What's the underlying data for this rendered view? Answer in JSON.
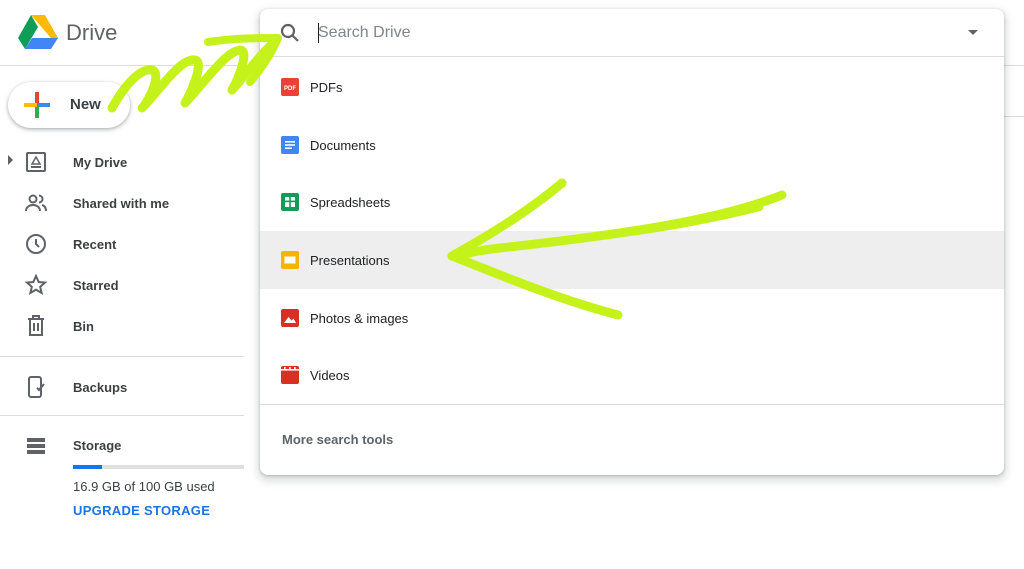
{
  "app": {
    "brand": "Drive"
  },
  "sidebar": {
    "new_label": "New",
    "items": [
      {
        "label": "My Drive",
        "icon": "my-drive-icon"
      },
      {
        "label": "Shared with me",
        "icon": "shared-icon"
      },
      {
        "label": "Recent",
        "icon": "clock-icon"
      },
      {
        "label": "Starred",
        "icon": "star-icon"
      },
      {
        "label": "Bin",
        "icon": "trash-icon"
      }
    ],
    "backups": {
      "label": "Backups",
      "icon": "backup-phone-icon"
    },
    "storage": {
      "label": "Storage",
      "used_text": "16.9 GB of 100 GB used",
      "used_fraction": 0.169,
      "upgrade_label": "UPGRADE STORAGE"
    }
  },
  "search": {
    "placeholder": "Search Drive",
    "file_types": [
      {
        "label": "PDFs",
        "icon": "pdf-icon",
        "color": "#ea4335"
      },
      {
        "label": "Documents",
        "icon": "document-icon",
        "color": "#4285f4"
      },
      {
        "label": "Spreadsheets",
        "icon": "spreadsheet-icon",
        "color": "#0f9d58"
      },
      {
        "label": "Presentations",
        "icon": "presentation-icon",
        "color": "#f4b400"
      },
      {
        "label": "Photos & images",
        "icon": "image-icon",
        "color": "#d93025"
      },
      {
        "label": "Videos",
        "icon": "video-icon",
        "color": "#d93025"
      }
    ],
    "highlighted": "Presentations",
    "more_tools": "More search tools"
  },
  "colors": {
    "accent": "#1a73e8",
    "annotation": "#c6f21c",
    "highlight_row": "#eeeeee"
  }
}
